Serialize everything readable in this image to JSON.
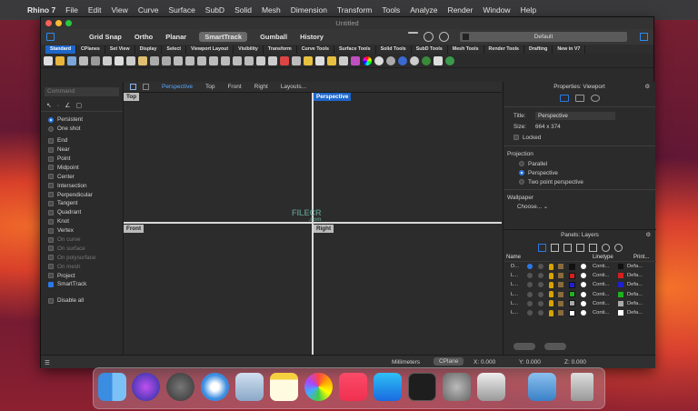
{
  "menubar": {
    "app_name": "Rhino 7",
    "items": [
      "File",
      "Edit",
      "View",
      "Curve",
      "Surface",
      "SubD",
      "Solid",
      "Mesh",
      "Dimension",
      "Transform",
      "Tools",
      "Analyze",
      "Render",
      "Window",
      "Help"
    ]
  },
  "window": {
    "title": "Untitled"
  },
  "commandbar": {
    "buttons": [
      "Grid Snap",
      "Ortho",
      "Planar",
      "SmartTrack",
      "Gumball",
      "History"
    ],
    "active": "SmartTrack",
    "layer_default": "Default"
  },
  "tabs": [
    "Standard",
    "CPlanes",
    "Set View",
    "Display",
    "Select",
    "Viewport Layout",
    "Visibility",
    "Transform",
    "Curve Tools",
    "Surface Tools",
    "Solid Tools",
    "SubD Tools",
    "Mesh Tools",
    "Render Tools",
    "Drafting",
    "New in V7"
  ],
  "active_tab": "Standard",
  "left_panel": {
    "command_placeholder": "Command",
    "persistent": "Persistent",
    "one_shot": "One shot",
    "osnaps": [
      {
        "label": "End",
        "checked": false,
        "dim": false
      },
      {
        "label": "Near",
        "checked": false,
        "dim": false
      },
      {
        "label": "Point",
        "checked": false,
        "dim": false
      },
      {
        "label": "Midpoint",
        "checked": false,
        "dim": false
      },
      {
        "label": "Center",
        "checked": false,
        "dim": false
      },
      {
        "label": "Intersection",
        "checked": false,
        "dim": false
      },
      {
        "label": "Perpendicular",
        "checked": false,
        "dim": false
      },
      {
        "label": "Tangent",
        "checked": false,
        "dim": false
      },
      {
        "label": "Quadrant",
        "checked": false,
        "dim": false
      },
      {
        "label": "Knot",
        "checked": false,
        "dim": false
      },
      {
        "label": "Vertex",
        "checked": false,
        "dim": false
      },
      {
        "label": "On curve",
        "checked": false,
        "dim": true
      },
      {
        "label": "On surface",
        "checked": false,
        "dim": true
      },
      {
        "label": "On polysurface",
        "checked": false,
        "dim": true
      },
      {
        "label": "On mesh",
        "checked": false,
        "dim": true
      },
      {
        "label": "Project",
        "checked": false,
        "dim": false
      },
      {
        "label": "SmartTrack",
        "checked": true,
        "dim": false
      }
    ],
    "disable_all": "Disable all"
  },
  "viewport_tabs": [
    "Perspective",
    "Top",
    "Front",
    "Right",
    "Layouts..."
  ],
  "viewports": {
    "top": "Top",
    "perspective": "Perspective",
    "front": "Front",
    "right": "Right"
  },
  "watermark": "FILECR",
  "watermark_sub": ".com",
  "properties": {
    "header": "Properties: Viewport",
    "title_label": "Title:",
    "title_value": "Perspective",
    "size_label": "Size:",
    "size_value": "664 x 374",
    "locked": "Locked",
    "projection": "Projection",
    "parallel": "Parallel",
    "perspective": "Perspective",
    "two_point": "Two point perspective",
    "wallpaper": "Wallpaper",
    "choose": "Choose..."
  },
  "layers": {
    "header": "Panels: Layers",
    "col_name": "Name",
    "col_linetype": "Linetype",
    "col_print": "Print...",
    "rows": [
      {
        "name": "D...",
        "current": true,
        "color": "#111111",
        "linetype": "Conti...",
        "print": "Defa...",
        "pcolor": "#111111"
      },
      {
        "name": "L...",
        "current": false,
        "color": "#d42020",
        "linetype": "Conti...",
        "print": "Defa...",
        "pcolor": "#d42020"
      },
      {
        "name": "L...",
        "current": false,
        "color": "#2020d0",
        "linetype": "Conti...",
        "print": "Defa...",
        "pcolor": "#2020d0"
      },
      {
        "name": "L...",
        "current": false,
        "color": "#20b020",
        "linetype": "Conti...",
        "print": "Defa...",
        "pcolor": "#20b020"
      },
      {
        "name": "L...",
        "current": false,
        "color": "#aaaaaa",
        "linetype": "Conti...",
        "print": "Defa...",
        "pcolor": "#aaaaaa"
      },
      {
        "name": "L...",
        "current": false,
        "color": "#ffffff",
        "linetype": "Conti...",
        "print": "Defa...",
        "pcolor": "#ffffff"
      }
    ]
  },
  "status": {
    "units": "Millimeters",
    "cplane": "CPlane",
    "x": "X: 0.000",
    "y": "Y: 0.000",
    "z": "Z: 0.000"
  },
  "dock_apps": [
    "Finder",
    "Siri",
    "Launchpad",
    "Safari",
    "Mail",
    "Notes",
    "Photos",
    "Music",
    "App Store",
    "Terminal",
    "System Preferences",
    "Rhino 7",
    "Downloads",
    "Trash"
  ],
  "colors": {
    "accent": "#1e66c9",
    "window_bg": "#2b2b2b"
  }
}
